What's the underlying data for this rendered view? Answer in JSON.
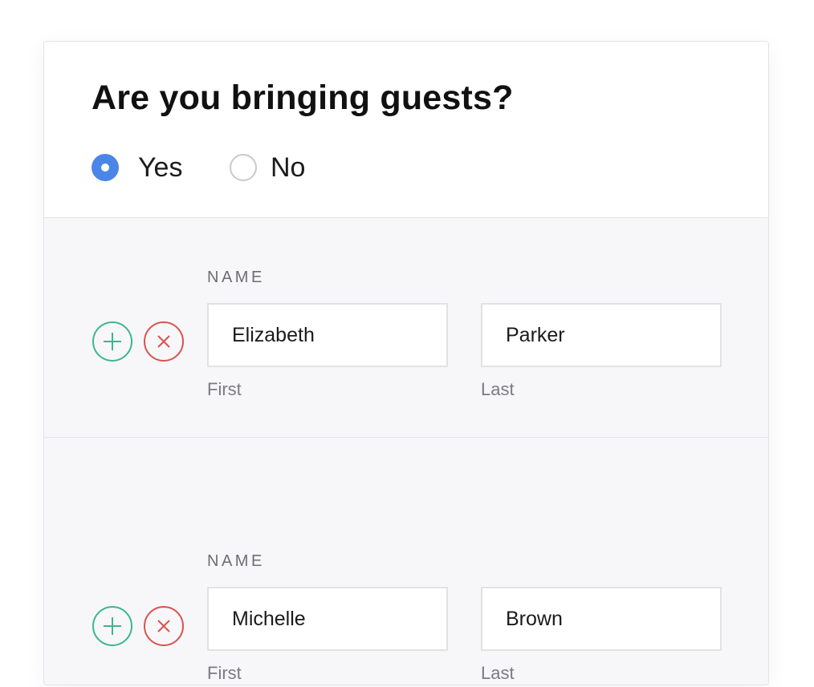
{
  "question": {
    "title": "Are you bringing guests?",
    "options": [
      {
        "label": "Yes",
        "selected": true
      },
      {
        "label": "No",
        "selected": false
      }
    ]
  },
  "guests": [
    {
      "section_label": "NAME",
      "first_name": "Elizabeth",
      "last_name": "Parker",
      "first_caption": "First",
      "last_caption": "Last",
      "add_icon": "plus-circle-icon",
      "remove_icon": "x-circle-icon"
    },
    {
      "section_label": "NAME",
      "first_name": "Michelle",
      "last_name": "Brown",
      "first_caption": "First",
      "last_caption": "Last",
      "add_icon": "plus-circle-icon",
      "remove_icon": "x-circle-icon"
    }
  ],
  "colors": {
    "accent": "#4a86e8",
    "add": "#3bb78f",
    "remove": "#d9534f",
    "row_background": "#f7f7f9"
  }
}
